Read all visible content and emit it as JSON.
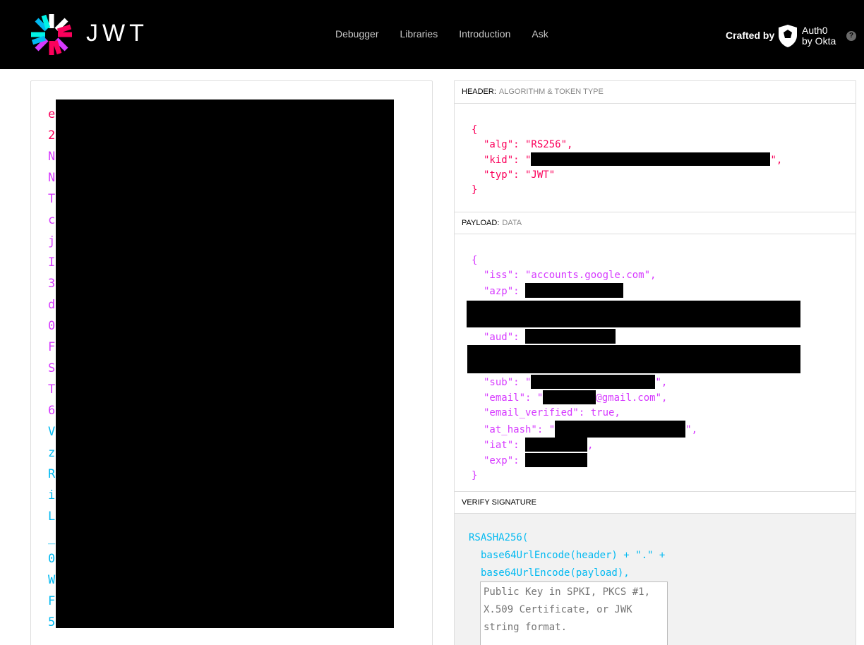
{
  "header": {
    "logo_text": "JWT",
    "nav": [
      "Debugger",
      "Libraries",
      "Introduction",
      "Ask"
    ],
    "crafted_by": "Crafted by",
    "auth0_line1": "Auth0",
    "auth0_line2": "by Okta",
    "help": "?"
  },
  "encoded": {
    "chars": [
      "e",
      "2",
      "N",
      "N",
      "T",
      "c",
      "j",
      "I",
      "3",
      "d",
      "0",
      "F",
      "S",
      "T",
      "6",
      "V",
      "z",
      "R",
      "i",
      "L",
      "_",
      "0",
      "W",
      "F",
      "5"
    ],
    "colors": [
      "#fb015b",
      "#fb015b",
      "#d63aff",
      "#d63aff",
      "#d63aff",
      "#d63aff",
      "#d63aff",
      "#d63aff",
      "#d63aff",
      "#d63aff",
      "#d63aff",
      "#d63aff",
      "#d63aff",
      "#d63aff",
      "#d63aff",
      "#00b9f1",
      "#00b9f1",
      "#00b9f1",
      "#00b9f1",
      "#00b9f1",
      "#00b9f1",
      "#00b9f1",
      "#00b9f1",
      "#00b9f1",
      "#00b9f1"
    ]
  },
  "decoded": {
    "header_title": "HEADER:",
    "header_sub": "ALGORITHM & TOKEN TYPE",
    "header_json": {
      "open": "{",
      "alg": "\"alg\": \"RS256\",",
      "kid_key": "\"kid\": \"",
      "kid_end": "\",",
      "typ": "\"typ\": \"JWT\"",
      "close": "}"
    },
    "payload_title": "PAYLOAD:",
    "payload_sub": "DATA",
    "payload_json": {
      "open": "{",
      "iss": "\"iss\": \"accounts.google.com\",",
      "azp": "\"azp\": ",
      "aud": "\"aud\": ",
      "sub_key": "\"sub\": \"",
      "sub_end": "\",",
      "email_key": "\"email\": \"",
      "email_end": "@gmail.com\",",
      "email_verified": "\"email_verified\": true,",
      "at_hash_key": "\"at_hash\": \"",
      "at_hash_end": "\",",
      "iat": "\"iat\": ",
      "iat_end": ",",
      "exp": "\"exp\": ",
      "close": "}"
    },
    "verify_title": "VERIFY SIGNATURE",
    "verify": {
      "fn": "RSASHA256(",
      "line1": "base64UrlEncode(header) + \".\" +",
      "line2": "base64UrlEncode(payload),",
      "key_placeholder": "Public Key in SPKI, PKCS #1, X.509 Certificate, or JWK string format."
    }
  },
  "colors": {
    "header": "#fb015b",
    "payload": "#d63aff",
    "signature": "#00b9f1"
  }
}
